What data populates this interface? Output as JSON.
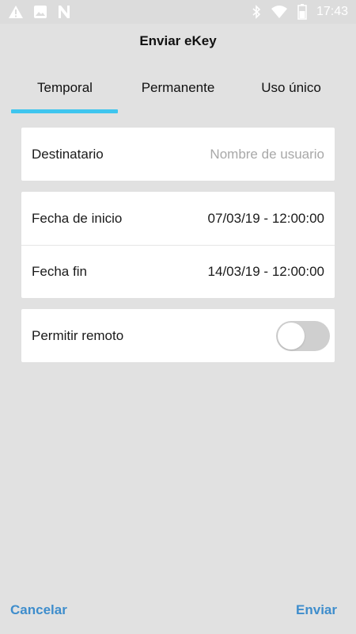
{
  "status_bar": {
    "time": "17:43",
    "left_icons": [
      "warning-icon",
      "image-icon",
      "n-app-icon"
    ],
    "right_icons": [
      "bluetooth-icon",
      "wifi-icon",
      "battery-icon"
    ]
  },
  "header": {
    "title": "Enviar eKey"
  },
  "tabs": [
    {
      "label": "Temporal",
      "selected": true
    },
    {
      "label": "Permanente",
      "selected": false
    },
    {
      "label": "Uso único",
      "selected": false
    }
  ],
  "form": {
    "recipient": {
      "label": "Destinatario",
      "placeholder": "Nombre de usuario",
      "value": ""
    },
    "start_date": {
      "label": "Fecha de inicio",
      "value": "07/03/19 - 12:00:00"
    },
    "end_date": {
      "label": "Fecha fin",
      "value": "14/03/19 - 12:00:00"
    },
    "remote": {
      "label": "Permitir remoto",
      "enabled": false
    }
  },
  "actions": {
    "cancel_label": "Cancelar",
    "send_label": "Enviar"
  },
  "colors": {
    "accent": "#3fc5ee",
    "action_text": "#3e8dcc",
    "background": "#e1e1e1"
  }
}
